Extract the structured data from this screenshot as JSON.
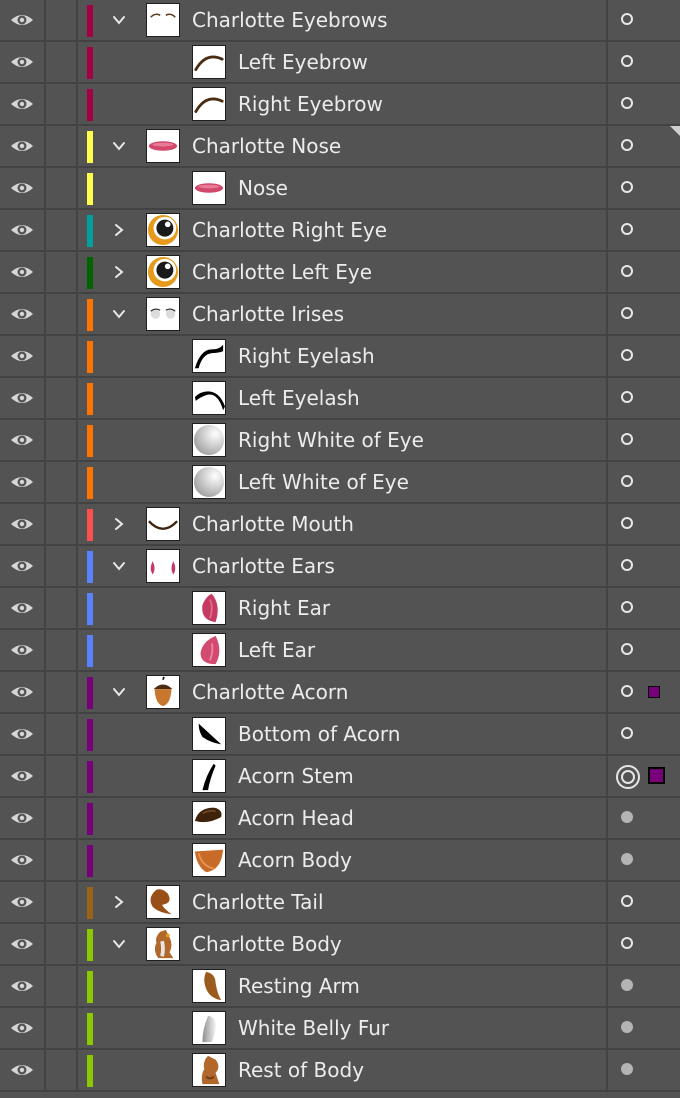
{
  "panel": {
    "layers": [
      {
        "name": "Charlotte Eyebrows",
        "indent": 0,
        "expander": "down",
        "color": "#a50046",
        "thumb": "eyebrows",
        "target": "empty"
      },
      {
        "name": "Left Eyebrow",
        "indent": 1,
        "color": "#a50046",
        "thumb": "eyebrow",
        "target": "empty"
      },
      {
        "name": "Right Eyebrow",
        "indent": 1,
        "color": "#a50046",
        "thumb": "eyebrow",
        "target": "empty"
      },
      {
        "name": "Charlotte Nose",
        "indent": 0,
        "expander": "down",
        "color": "#ffff4b",
        "thumb": "nose",
        "target": "empty"
      },
      {
        "name": "Nose",
        "indent": 1,
        "color": "#ffff4b",
        "thumb": "nose",
        "target": "empty"
      },
      {
        "name": "Charlotte Right Eye",
        "indent": 0,
        "expander": "right",
        "color": "#00a0a0",
        "thumb": "eye",
        "target": "empty"
      },
      {
        "name": "Charlotte Left Eye",
        "indent": 0,
        "expander": "right",
        "color": "#006400",
        "thumb": "eye",
        "target": "empty"
      },
      {
        "name": "Charlotte Irises",
        "indent": 0,
        "expander": "down",
        "color": "#ff7300",
        "thumb": "irises",
        "target": "empty"
      },
      {
        "name": "Right Eyelash",
        "indent": 1,
        "color": "#ff7300",
        "thumb": "eyelash-right",
        "target": "empty"
      },
      {
        "name": "Left Eyelash",
        "indent": 1,
        "color": "#ff7300",
        "thumb": "eyelash-left",
        "target": "empty"
      },
      {
        "name": "Right White of Eye",
        "indent": 1,
        "color": "#ff7300",
        "thumb": "white",
        "target": "empty"
      },
      {
        "name": "Left White of Eye",
        "indent": 1,
        "color": "#ff7300",
        "thumb": "white",
        "target": "empty"
      },
      {
        "name": "Charlotte Mouth",
        "indent": 0,
        "expander": "right",
        "color": "#ff5050",
        "thumb": "mouth",
        "target": "empty"
      },
      {
        "name": "Charlotte Ears",
        "indent": 0,
        "expander": "down",
        "color": "#5a82ff",
        "thumb": "ears",
        "target": "empty"
      },
      {
        "name": "Right Ear",
        "indent": 1,
        "color": "#5a82ff",
        "thumb": "ear-right",
        "target": "empty"
      },
      {
        "name": "Left Ear",
        "indent": 1,
        "color": "#5a82ff",
        "thumb": "ear-left",
        "target": "empty"
      },
      {
        "name": "Charlotte Acorn",
        "indent": 0,
        "expander": "down",
        "color": "#780078",
        "thumb": "acorn",
        "target": "empty",
        "selected": "small"
      },
      {
        "name": "Bottom of Acorn",
        "indent": 1,
        "color": "#780078",
        "thumb": "acorn-bottom",
        "target": "empty"
      },
      {
        "name": "Acorn Stem",
        "indent": 1,
        "color": "#780078",
        "thumb": "acorn-stem",
        "target": "double",
        "selected": "big"
      },
      {
        "name": "Acorn Head",
        "indent": 1,
        "color": "#780078",
        "thumb": "acorn-head",
        "target": "filled"
      },
      {
        "name": "Acorn Body",
        "indent": 1,
        "color": "#780078",
        "thumb": "acorn-body",
        "target": "filled"
      },
      {
        "name": "Charlotte Tail",
        "indent": 0,
        "expander": "right",
        "color": "#9b6414",
        "thumb": "tail",
        "target": "empty"
      },
      {
        "name": "Charlotte Body",
        "indent": 0,
        "expander": "down",
        "color": "#8cc800",
        "thumb": "body",
        "target": "empty"
      },
      {
        "name": "Resting Arm",
        "indent": 1,
        "color": "#8cc800",
        "thumb": "arm",
        "target": "filled"
      },
      {
        "name": "White Belly Fur",
        "indent": 1,
        "color": "#8cc800",
        "thumb": "belly",
        "target": "filled"
      },
      {
        "name": "Rest of Body",
        "indent": 1,
        "color": "#8cc800",
        "thumb": "rest-body",
        "target": "filled"
      }
    ]
  }
}
